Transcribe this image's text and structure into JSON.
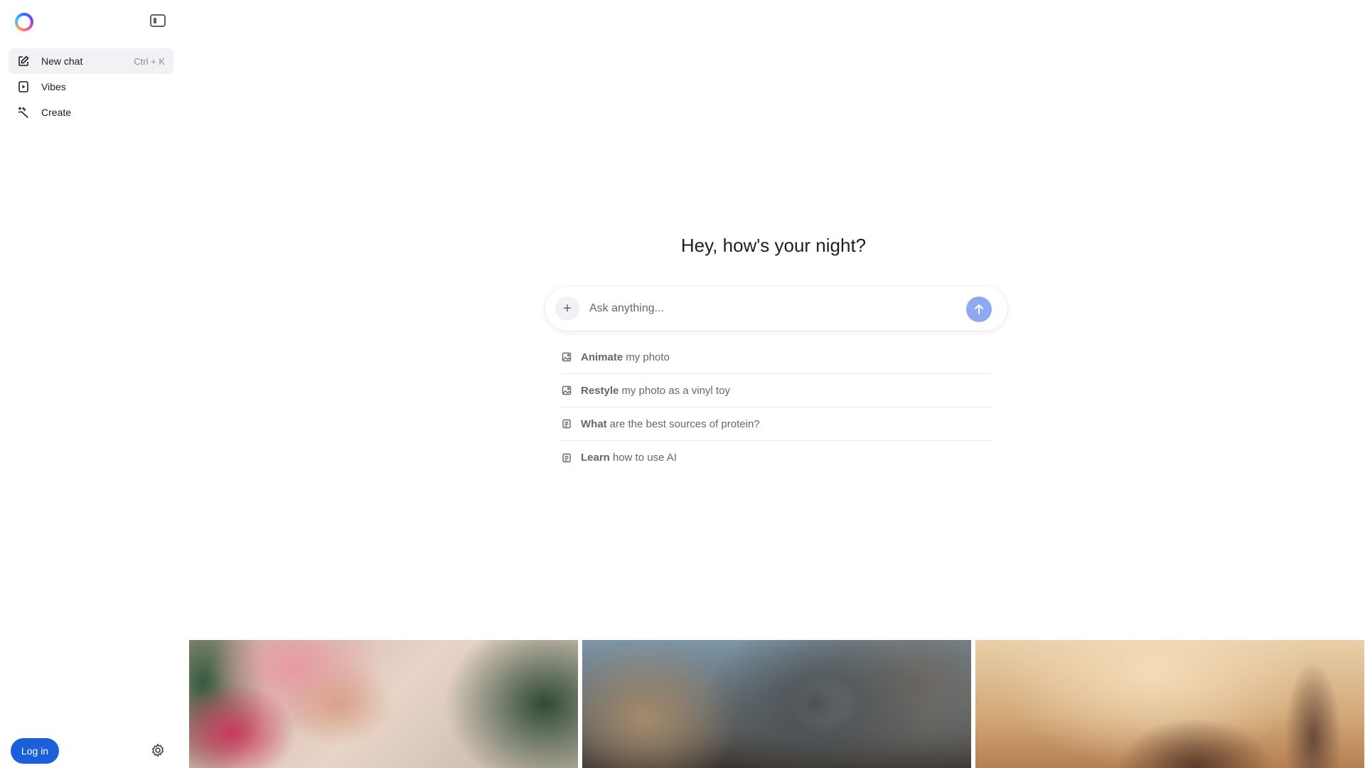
{
  "sidebar": {
    "nav": [
      {
        "label": "New chat",
        "shortcut": "Ctrl + K",
        "icon": "edit-icon"
      },
      {
        "label": "Vibes",
        "icon": "vibes-icon"
      },
      {
        "label": "Create",
        "icon": "sparkle-wand-icon"
      }
    ],
    "login_label": "Log in"
  },
  "main": {
    "greeting": "Hey, how's your night?",
    "composer": {
      "placeholder": "Ask anything..."
    },
    "suggestions": [
      {
        "bold": "Animate",
        "rest": "my photo",
        "icon": "image-icon"
      },
      {
        "bold": "Restyle",
        "rest": "my photo as a vinyl toy",
        "icon": "image-icon"
      },
      {
        "bold": "What",
        "rest": "are the best sources of protein?",
        "icon": "document-icon"
      },
      {
        "bold": "Learn",
        "rest": "how to use AI",
        "icon": "document-icon"
      }
    ]
  },
  "colors": {
    "accent": "#1b5fd9",
    "send_button": "#8ea9ee",
    "active_nav_bg": "#f0f2f5"
  }
}
